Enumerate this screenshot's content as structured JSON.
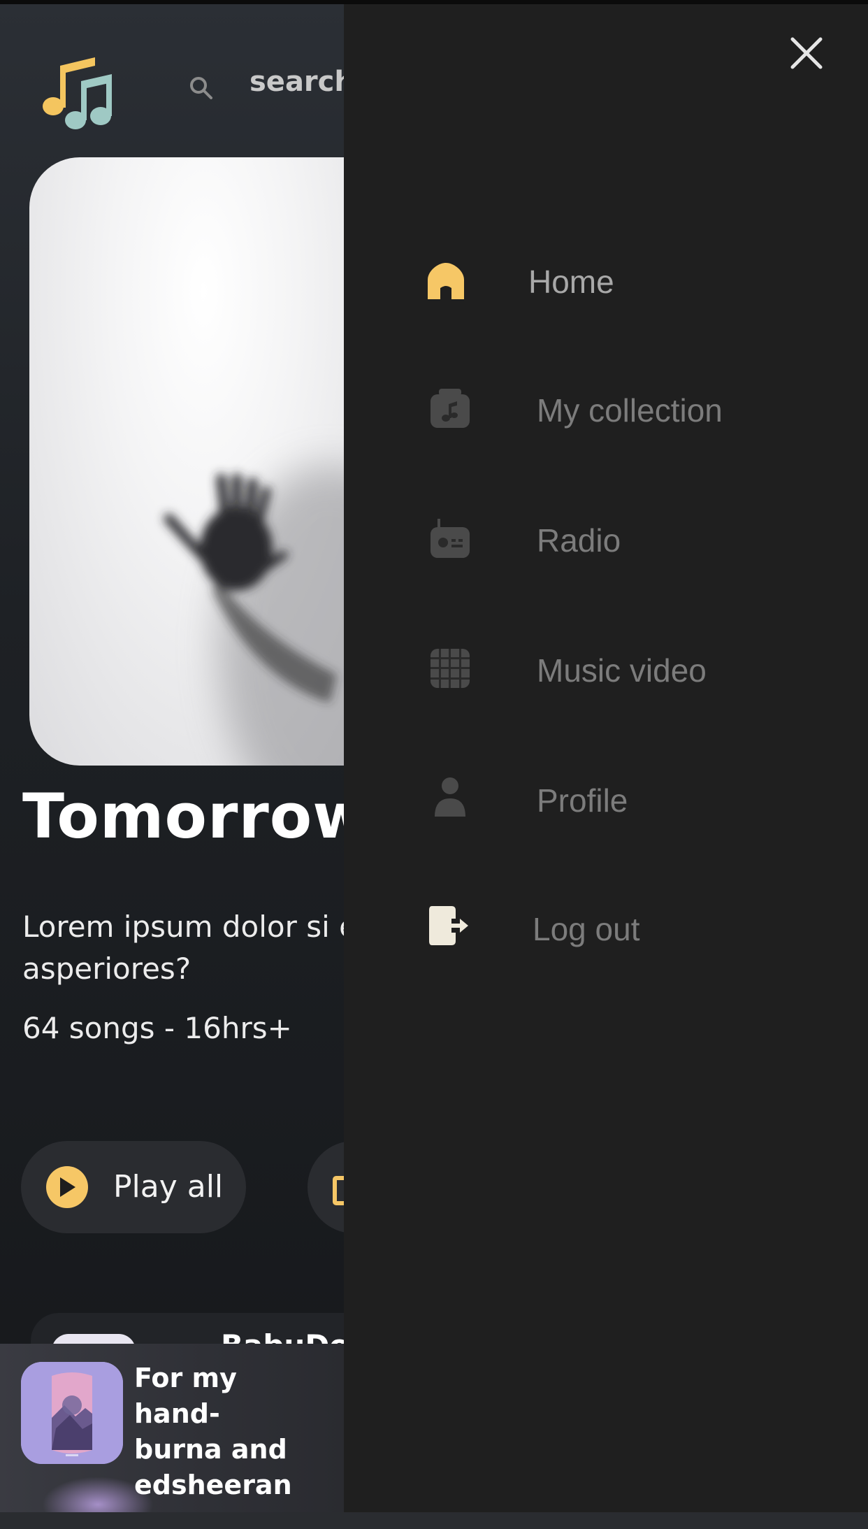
{
  "search": {
    "placeholder": "search"
  },
  "hero": {
    "title": "Tomorrow",
    "description": "Lorem ipsum dolor si elit. A, asperiores?",
    "meta": "64 songs - 16hrs+"
  },
  "actions": {
    "play_all_label": "Play all"
  },
  "songs": [
    {
      "title": "BabuDo"
    }
  ],
  "player": {
    "track_title": "For my hand- burna and edsheeran"
  },
  "drawer": {
    "menu": [
      {
        "label": "Home",
        "icon": "home-icon",
        "active": true
      },
      {
        "label": "My collection",
        "icon": "collection-icon",
        "active": false
      },
      {
        "label": "Radio",
        "icon": "radio-icon",
        "active": false
      },
      {
        "label": "Music video",
        "icon": "music-video-icon",
        "active": false
      },
      {
        "label": "Profile",
        "icon": "profile-icon",
        "active": false
      },
      {
        "label": "Log out",
        "icon": "logout-icon",
        "active": false
      }
    ]
  },
  "colors": {
    "accent": "#F6C766",
    "drawer_bg": "#1F1F1F",
    "page_bg": "#1D2024",
    "muted_text": "#7C7C7C"
  }
}
